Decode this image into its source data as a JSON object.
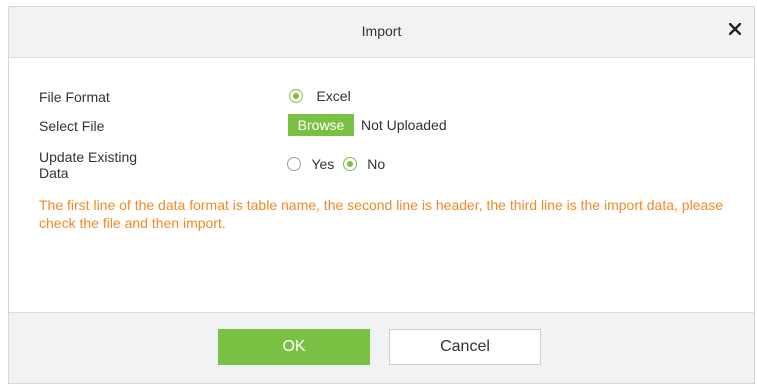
{
  "dialog": {
    "title": "Import",
    "close_icon": "close-icon"
  },
  "form": {
    "file_format": {
      "label": "File Format",
      "option": "Excel",
      "selected": true
    },
    "select_file": {
      "label": "Select File",
      "browse_label": "Browse",
      "status": "Not Uploaded"
    },
    "update_existing": {
      "label_line1": "Update Existing",
      "label_line2": "Data",
      "options": [
        {
          "label": "Yes",
          "selected": false
        },
        {
          "label": "No",
          "selected": true
        }
      ]
    },
    "hint": "The first line of the data format is table name, the second line is header, the third line is the import data, please check the file and then import."
  },
  "footer": {
    "ok_label": "OK",
    "cancel_label": "Cancel"
  },
  "colors": {
    "accent": "#7ac143",
    "hint": "#f08a24",
    "header_bg": "#f1f2f4"
  }
}
